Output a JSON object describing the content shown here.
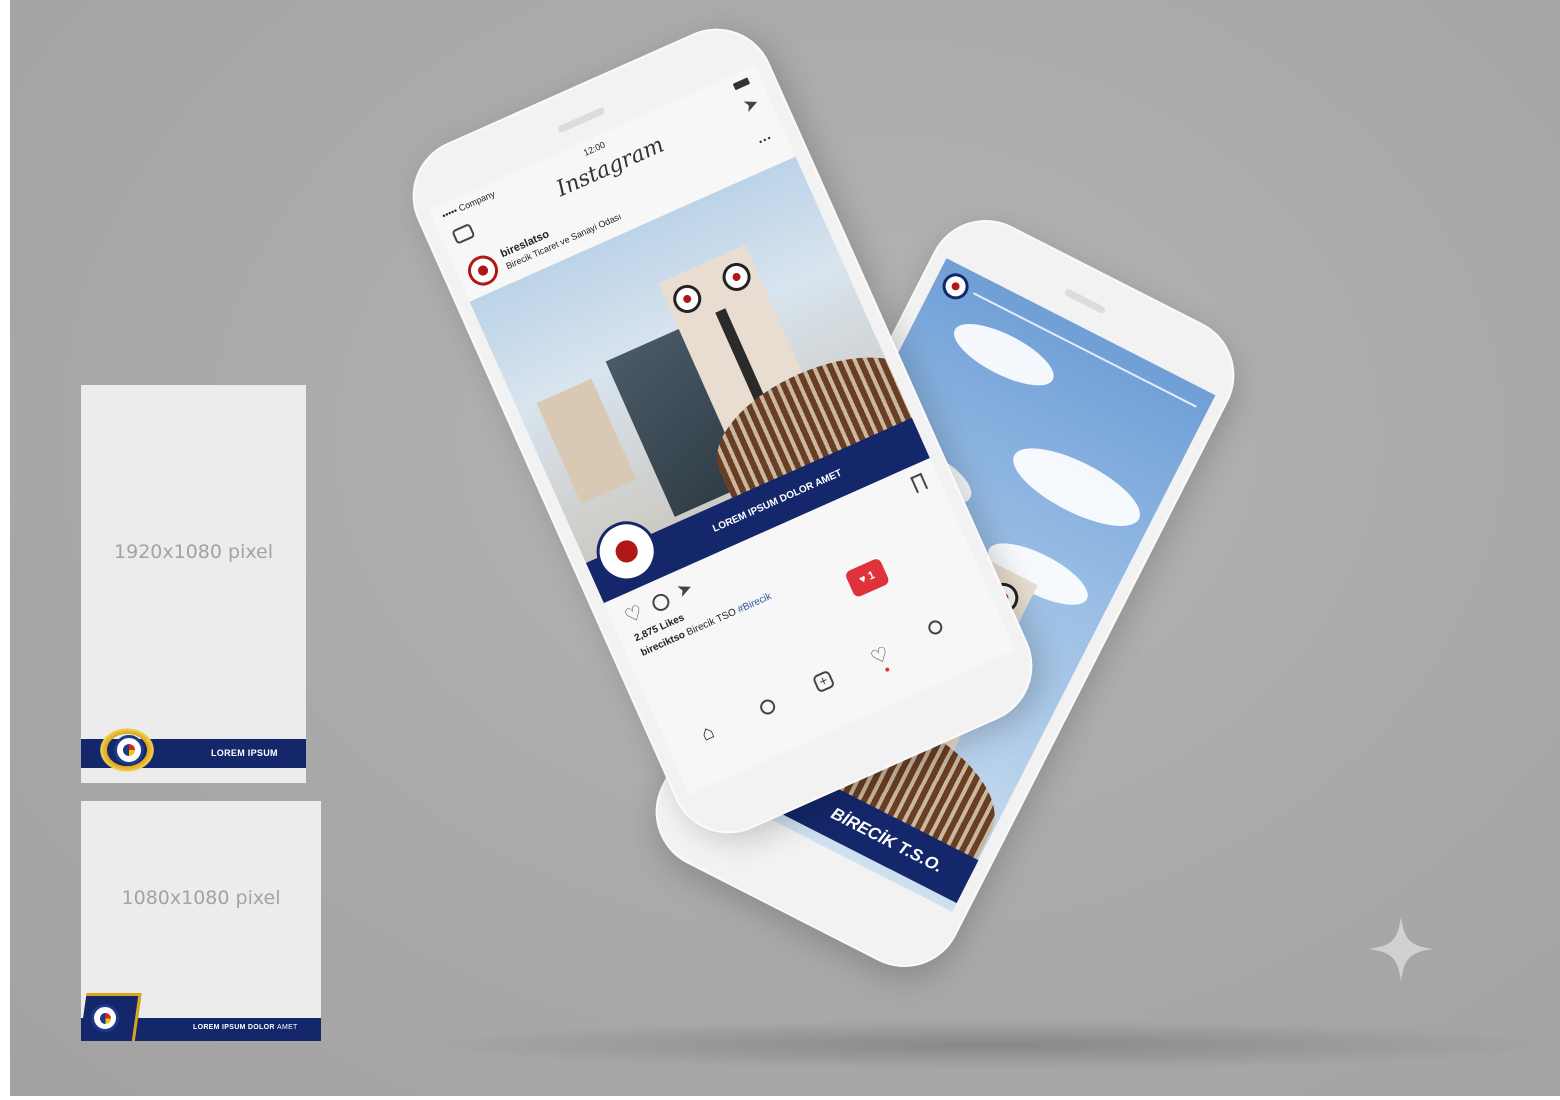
{
  "templates": {
    "story": {
      "size_label": "1920x1080 pixel",
      "band_text": "LOREM IPSUM"
    },
    "post": {
      "size_label": "1080x1080 pixel",
      "band_text_bold": "LOREM IPSUM DOLOR",
      "band_text_light": "AMET"
    }
  },
  "phone_front": {
    "status": {
      "carrier": "••••• Company",
      "time": "12:00"
    },
    "app_title": "Instagram",
    "account_name": "bireslatso",
    "account_subtitle": "Birecik Ticaret ve Sanayi Odası",
    "image_band_text": "LOREM IPSUM DOLOR AMET",
    "likes": "2,875 Likes",
    "caption_user": "bireciktso",
    "caption_text": "Birecik TSO",
    "caption_hashtag": "#Birecik",
    "notification_count": "1",
    "more_icon": "···"
  },
  "phone_back": {
    "band_text": "BİRECİK T.S.O."
  },
  "colors": {
    "navy": "#14276a",
    "background": "#a9a9a9",
    "notification": "#e0323b"
  },
  "icons": [
    "camera-icon",
    "direct-send-icon",
    "heart-icon",
    "comment-icon",
    "share-icon",
    "bookmark-icon",
    "home-icon",
    "search-icon",
    "add-post-icon",
    "activity-icon",
    "profile-icon",
    "sparkle-icon"
  ]
}
